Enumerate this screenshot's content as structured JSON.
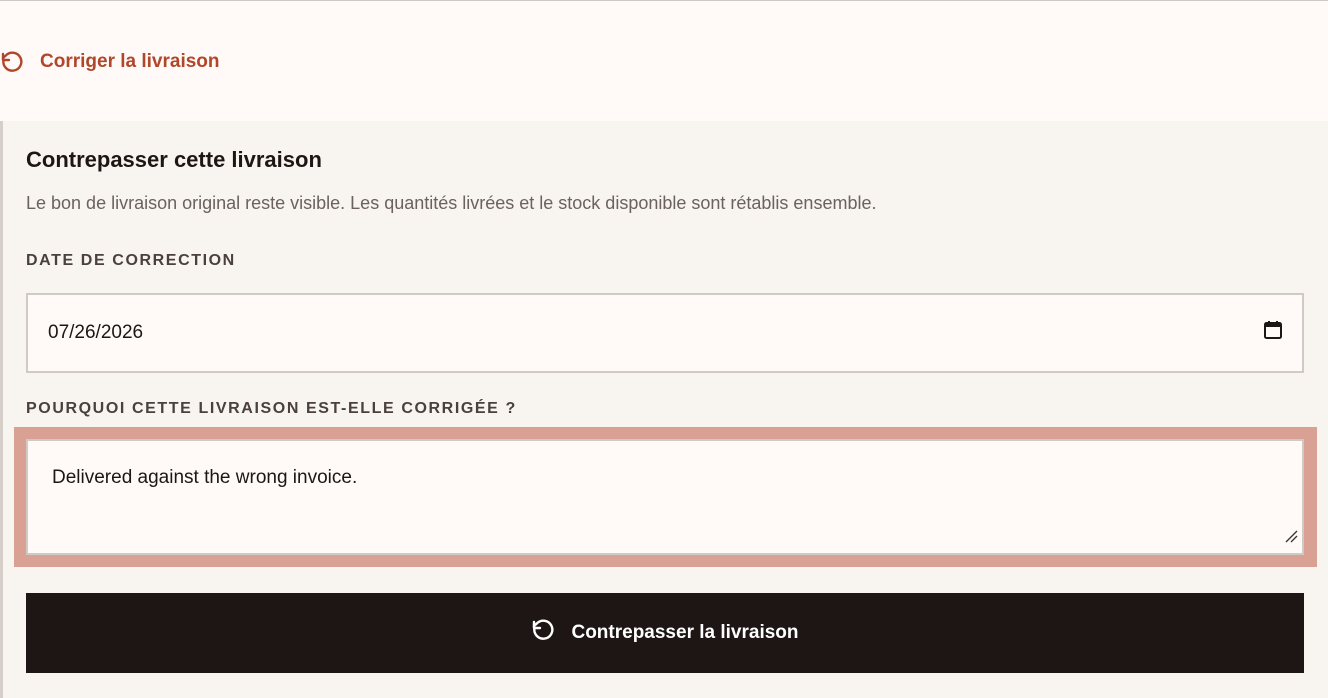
{
  "header": {
    "correct_link_label": "Corriger la livraison",
    "correct_link_icon": "undo-icon"
  },
  "panel": {
    "title": "Contrepasser cette livraison",
    "description": "Le bon de livraison original reste visible. Les quantités livrées et le stock disponible sont rétablis ensemble.",
    "date_field": {
      "label": "DATE DE CORRECTION",
      "value": "07/26/2026",
      "icon": "calendar-icon"
    },
    "reason_field": {
      "label": "POURQUOI CETTE LIVRAISON EST-ELLE CORRIGÉE ?",
      "value": "Delivered against the wrong invoice."
    },
    "submit": {
      "label": "Contrepasser la livraison",
      "icon": "undo-icon"
    }
  },
  "colors": {
    "accent": "#b0472a",
    "button_bg": "#1e1614",
    "focus_ring": "#d8a193",
    "panel_bg": "#f8f4ef",
    "page_bg": "#fffaf7"
  }
}
